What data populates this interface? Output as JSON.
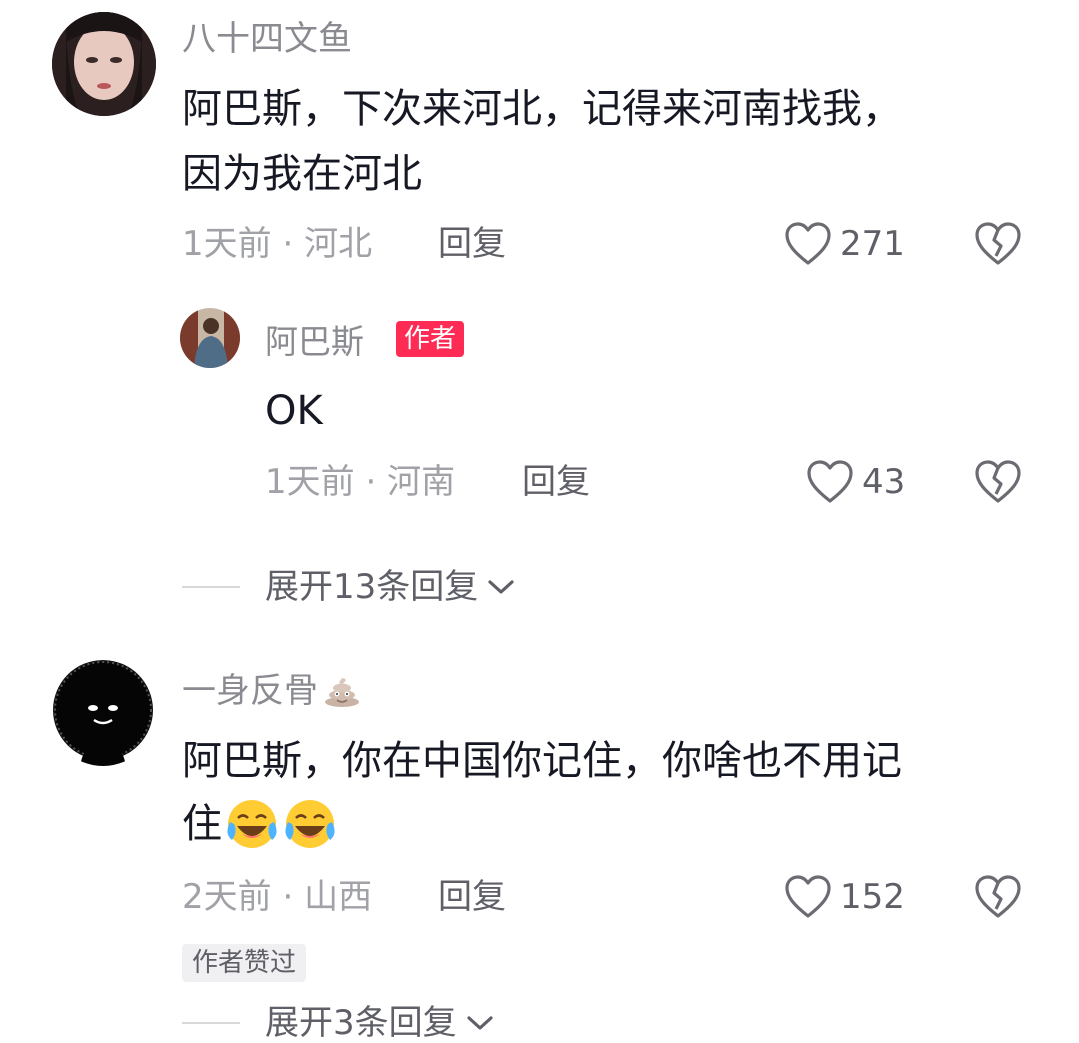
{
  "comments": [
    {
      "username": "八十四文鱼",
      "text_line1": "阿巴斯，下次来河北，记得来河南找我，",
      "text_line2": "因为我在河北",
      "time": "1天前",
      "location": "河北",
      "reply_label": "回复",
      "likes": "271",
      "replies": [
        {
          "username": "阿巴斯",
          "badge": "作者",
          "text": "OK",
          "time": "1天前",
          "location": "河南",
          "reply_label": "回复",
          "likes": "43"
        }
      ],
      "expand_label": "展开13条回复"
    },
    {
      "username": "一身反骨",
      "username_emoji": "poop-emoji",
      "text_line1": "阿巴斯，你在中国你记住，你啥也不用记",
      "text_line2": "住",
      "text_emojis": [
        "crying-laughing-emoji",
        "crying-laughing-emoji"
      ],
      "time": "2天前",
      "location": "山西",
      "reply_label": "回复",
      "likes": "152",
      "author_liked_chip": "作者赞过",
      "expand_label": "展开3条回复"
    }
  ],
  "separator": "·",
  "colors": {
    "badge_red": "#fe2c55",
    "name_gray": "#8a8b91",
    "meta_gray": "#a1a2a7",
    "text_dark": "#161823"
  }
}
